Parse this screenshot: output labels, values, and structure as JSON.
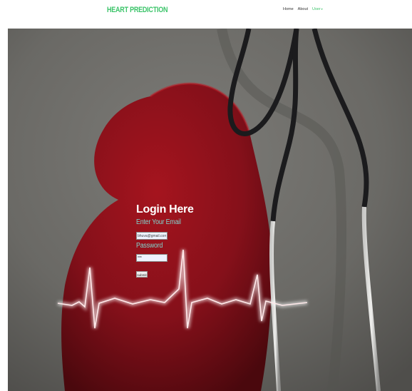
{
  "navbar": {
    "brand": "HEART PREDICTION",
    "links": [
      {
        "label": "Home"
      },
      {
        "label": "About"
      },
      {
        "label": "User"
      }
    ],
    "user_caret": "▾"
  },
  "login": {
    "title": "Login Here",
    "email_label": "Enter Your Email",
    "email_value": "bhuva@gmail.com",
    "password_label": "Password",
    "password_value": "***",
    "submit_label": "submit"
  },
  "colors": {
    "brand": "#3cc46a",
    "label_accent": "#7fd6cf",
    "heart_red": "#8f1018"
  }
}
